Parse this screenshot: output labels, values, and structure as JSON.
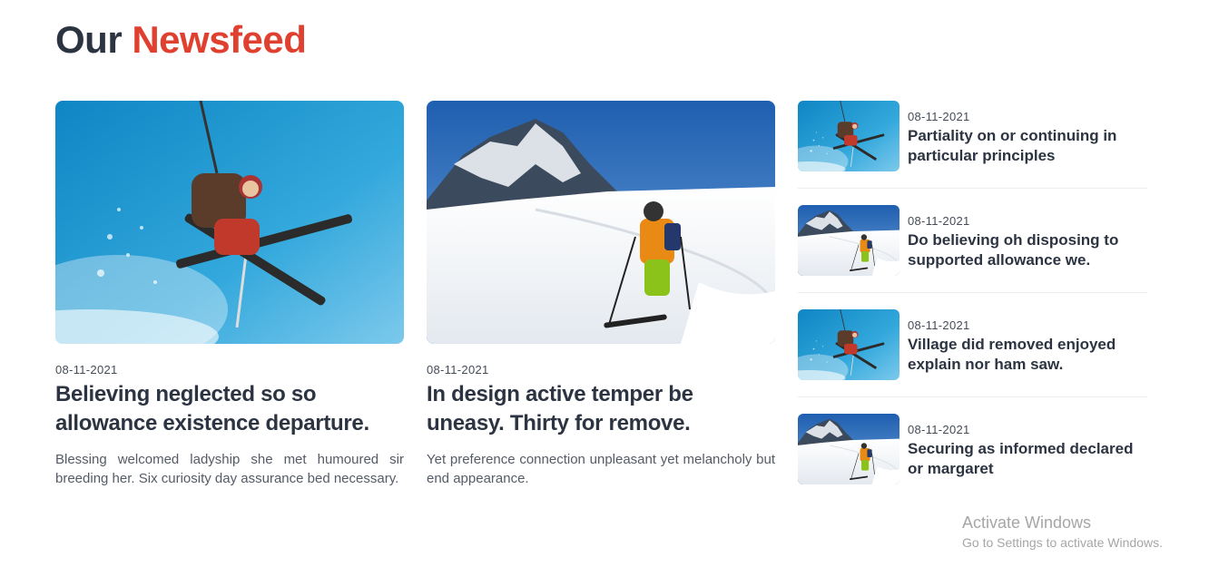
{
  "heading": {
    "prefix": "Our",
    "accent": "Newsfeed"
  },
  "featured": [
    {
      "image": "ski-jump-blue-sky",
      "date": "08-11-2021",
      "title": "Believing neglected so so allowance existence departure.",
      "description": "Blessing welcomed ladyship she met humoured sir breeding her. Six curiosity day assurance bed necessary."
    },
    {
      "image": "skier-mountain-slope",
      "date": "08-11-2021",
      "title": "In design active temper be uneasy. Thirty for remove.",
      "description": "Yet preference connection unpleasant yet melancholy but end appearance."
    }
  ],
  "sidebar": [
    {
      "image": "ski-jump-blue-sky",
      "date": "08-11-2021",
      "title": "Partiality on or continuing in particular principles"
    },
    {
      "image": "skier-mountain-slope",
      "date": "08-11-2021",
      "title": "Do believing oh disposing to supported allowance we."
    },
    {
      "image": "ski-jump-blue-sky",
      "date": "08-11-2021",
      "title": "Village did removed enjoyed explain nor ham saw."
    },
    {
      "image": "skier-mountain-slope",
      "date": "08-11-2021",
      "title": "Securing as informed declared or margaret"
    }
  ],
  "watermark": {
    "line1": "Activate Windows",
    "line2": "Go to Settings to activate Windows."
  },
  "colors": {
    "accent": "#e0402f",
    "heading": "#2c3442",
    "sky": "#2a9fd6",
    "snow": "#f3f6f9"
  }
}
